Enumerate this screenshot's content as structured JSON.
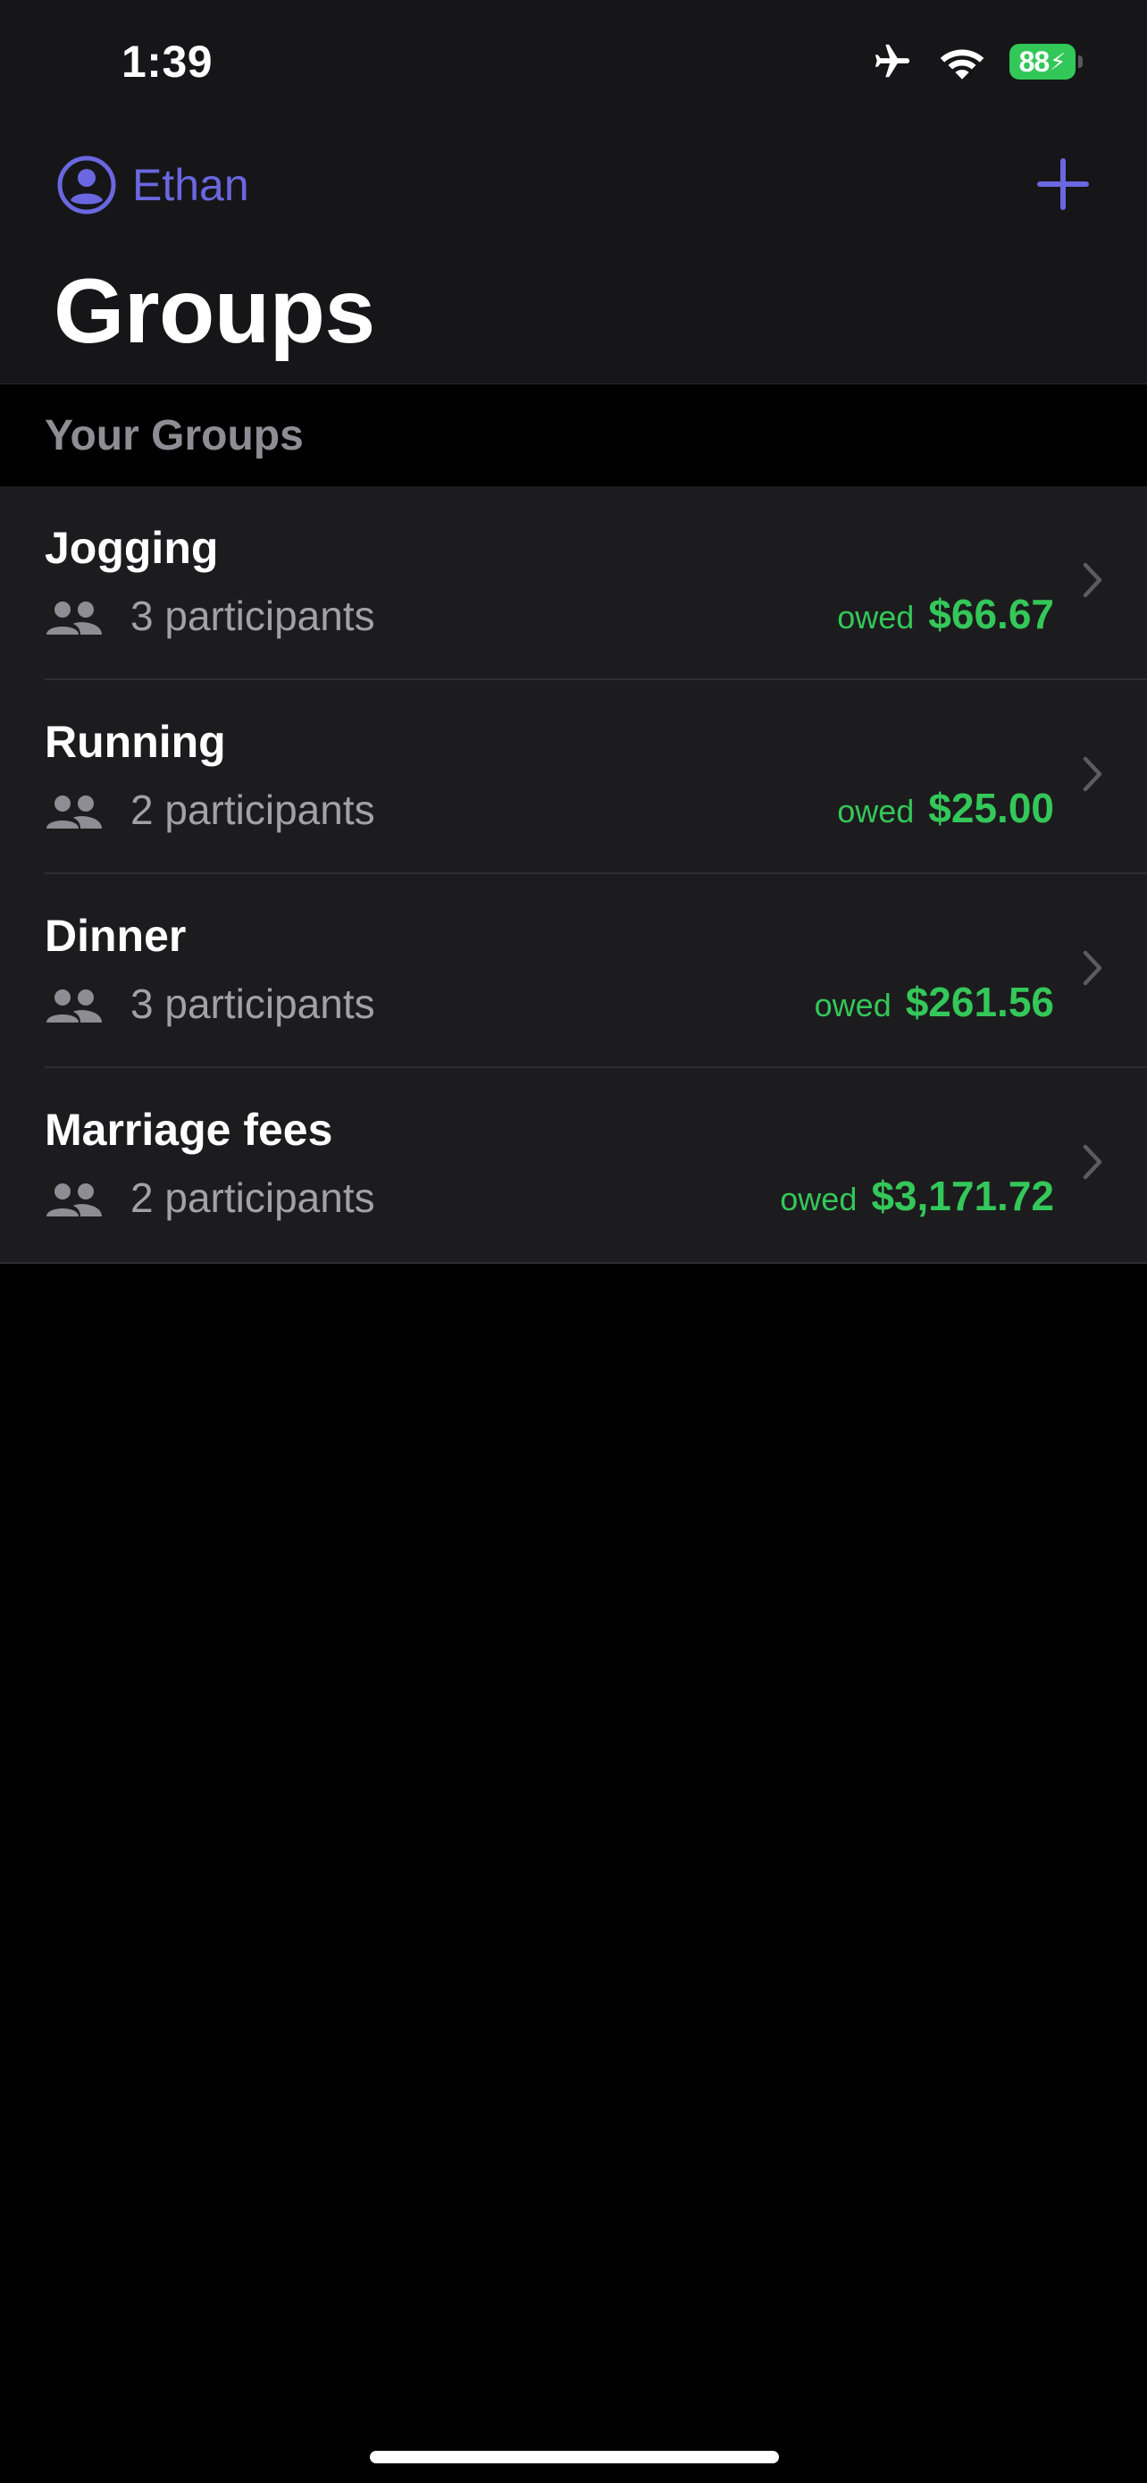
{
  "status_bar": {
    "time": "1:39",
    "battery_level": "88",
    "battery_color": "#32c759",
    "icons": [
      "airplane-icon",
      "wifi-icon",
      "battery-icon"
    ]
  },
  "header": {
    "profile_name": "Ethan",
    "profile_icon": "person-circle-icon",
    "add_icon": "plus-icon",
    "title": "Groups",
    "accent_color": "#6a67e0"
  },
  "section": {
    "title": "Your Groups"
  },
  "groups": [
    {
      "name": "Jogging",
      "participants": "3 participants",
      "owed_label": "owed",
      "owed_amount": "$66.67"
    },
    {
      "name": "Running",
      "participants": "2 participants",
      "owed_label": "owed",
      "owed_amount": "$25.00"
    },
    {
      "name": "Dinner",
      "participants": "3 participants",
      "owed_label": "owed",
      "owed_amount": "$261.56"
    },
    {
      "name": "Marriage fees",
      "participants": "2 participants",
      "owed_label": "owed",
      "owed_amount": "$3,171.72"
    }
  ],
  "colors": {
    "owed": "#34c759",
    "background": "#000000",
    "row_background": "#1c1c1e"
  }
}
